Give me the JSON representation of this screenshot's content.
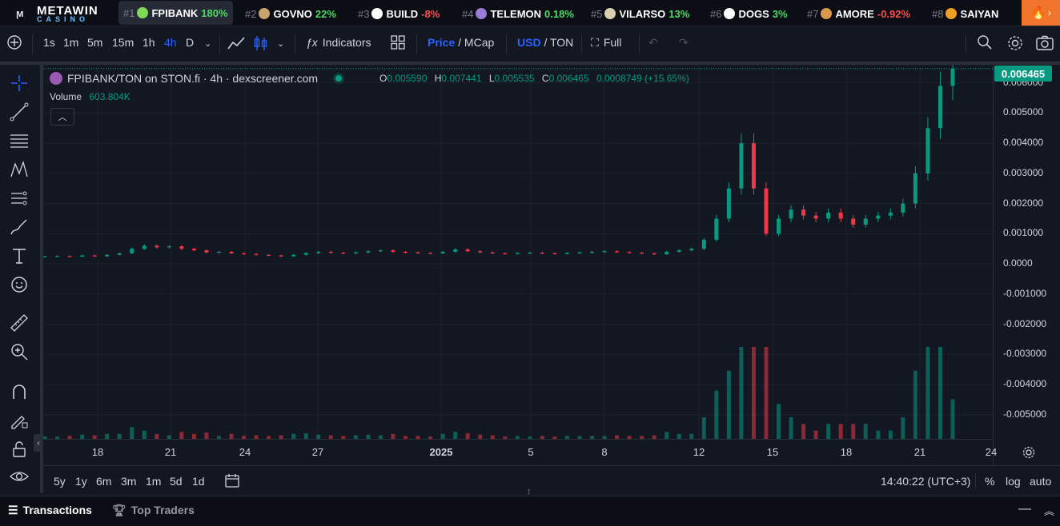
{
  "ticker": {
    "logo_top": "METAWIN",
    "logo_bottom": "CASINO",
    "items": [
      {
        "rank": "#1",
        "symbol": "FPIBANK",
        "change": "180%",
        "dir": "pos",
        "coin_color": "#7ed957"
      },
      {
        "rank": "#2",
        "symbol": "GOVNO",
        "change": "22%",
        "dir": "pos",
        "coin_color": "#c8a36b"
      },
      {
        "rank": "#3",
        "symbol": "BUILD",
        "change": "-8%",
        "dir": "neg",
        "coin_color": "#ffffff"
      },
      {
        "rank": "#4",
        "symbol": "TELEMON",
        "change": "0.18%",
        "dir": "pos",
        "coin_color": "#9b7bd8"
      },
      {
        "rank": "#5",
        "symbol": "VILARSO",
        "change": "13%",
        "dir": "pos",
        "coin_color": "#d8d0b0"
      },
      {
        "rank": "#6",
        "symbol": "DOGS",
        "change": "3%",
        "dir": "pos",
        "coin_color": "#ffffff"
      },
      {
        "rank": "#7",
        "symbol": "AMORE",
        "change": "-0.92%",
        "dir": "neg",
        "coin_color": "#d89a4a"
      },
      {
        "rank": "#8",
        "symbol": "SAIYAN",
        "change": "",
        "dir": "pos",
        "coin_color": "#f0a020"
      }
    ]
  },
  "toolbar": {
    "intervals": [
      "1s",
      "1m",
      "5m",
      "15m",
      "1h",
      "4h",
      "D"
    ],
    "active_interval": "4h",
    "indicators_label": "Indicators",
    "price_label": "Price",
    "mcap_label": "MCap",
    "usd_label": "USD",
    "ton_label": "TON",
    "full_label": "Full",
    "slash": "/"
  },
  "legend": {
    "pair": "FPIBANK/TON on STON.fi · 4h · dexscreener.com",
    "o_key": "O",
    "o_val": "0.005590",
    "h_key": "H",
    "h_val": "0.007441",
    "l_key": "L",
    "l_val": "0.005535",
    "c_key": "C",
    "c_val": "0.006465",
    "change": "0.0008749 (+15.65%)",
    "volume_label": "Volume",
    "volume_value": "603.804K"
  },
  "price_axis": {
    "last_price": "0.006465",
    "labels": [
      "0.006000",
      "0.005000",
      "0.004000",
      "0.003000",
      "0.002000",
      "0.001000",
      "0.0000",
      "-0.001000",
      "-0.002000",
      "-0.003000",
      "-0.004000",
      "-0.005000"
    ]
  },
  "time_axis": {
    "labels": [
      "18",
      "21",
      "24",
      "27",
      "2025",
      "5",
      "8",
      "12",
      "15",
      "18",
      "21",
      "24"
    ]
  },
  "bottom_bar": {
    "ranges": [
      "5y",
      "1y",
      "6m",
      "3m",
      "1m",
      "5d",
      "1d"
    ],
    "clock": "14:40:22 (UTC+3)",
    "percent": "%",
    "log": "log",
    "auto": "auto"
  },
  "tabs": {
    "transactions": "Transactions",
    "top_traders": "Top Traders"
  },
  "chart_data": {
    "type": "candlestick",
    "title": "FPIBANK/TON on STON.fi · 4h · dexscreener.com",
    "ylim": [
      -0.0058,
      0.0066
    ],
    "up_color": "#089981",
    "down_color": "#f23645",
    "x_ticks": [
      "18",
      "21",
      "24",
      "27",
      "2025",
      "5",
      "8",
      "12",
      "15",
      "18",
      "21",
      "24"
    ],
    "series": [
      {
        "name": "price",
        "comment_levels": "approximate close price per 4h bar",
        "values": [
          0.00025,
          0.00026,
          0.00024,
          0.00028,
          0.00025,
          0.0003,
          0.00035,
          0.0005,
          0.0006,
          0.00055,
          0.00058,
          0.0005,
          0.00045,
          0.00038,
          0.0004,
          0.00035,
          0.00033,
          0.0003,
          0.00028,
          0.00025,
          0.0003,
          0.00036,
          0.0004,
          0.00037,
          0.00035,
          0.00038,
          0.00042,
          0.00045,
          0.0004,
          0.00038,
          0.00036,
          0.00035,
          0.0004,
          0.00048,
          0.00042,
          0.00038,
          0.00035,
          0.00034,
          0.00036,
          0.00037,
          0.00035,
          0.00034,
          0.00036,
          0.00038,
          0.0004,
          0.00042,
          0.00039,
          0.00037,
          0.00035,
          0.00032,
          0.0004,
          0.00045,
          0.0005,
          0.0008,
          0.0015,
          0.0025,
          0.004,
          0.0025,
          0.001,
          0.0015,
          0.0018,
          0.0016,
          0.0015,
          0.0017,
          0.0015,
          0.0013,
          0.0015,
          0.0016,
          0.0017,
          0.002,
          0.003,
          0.0045,
          0.0059,
          0.00647
        ]
      }
    ],
    "volume_label": "Volume",
    "volume_last": "603.804K"
  }
}
